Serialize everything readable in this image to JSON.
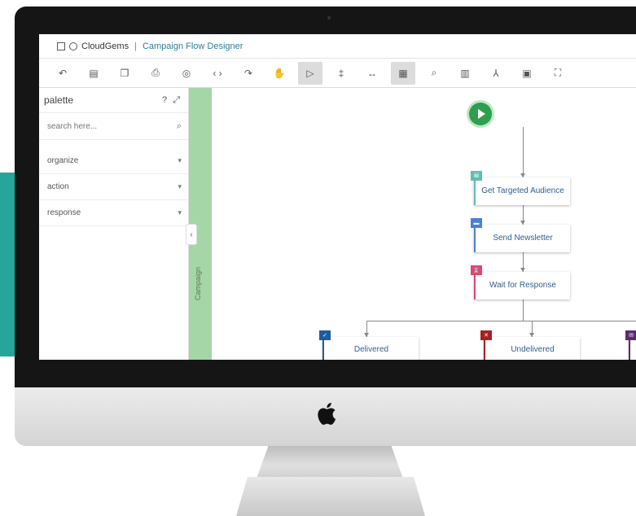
{
  "window": {
    "brand": "CloudGems",
    "separator": "|",
    "title": "Campaign Flow Designer"
  },
  "toolbar": {
    "tools": [
      {
        "icon": "undo-icon",
        "glyph": "↶",
        "active": false
      },
      {
        "icon": "page-icon",
        "glyph": "▤",
        "active": false
      },
      {
        "icon": "copy-icon",
        "glyph": "❐",
        "active": false
      },
      {
        "icon": "print-icon",
        "glyph": "⎙",
        "active": false
      },
      {
        "icon": "eye-icon",
        "glyph": "◎",
        "active": false
      },
      {
        "icon": "code-icon",
        "glyph": "‹ ›",
        "active": false
      },
      {
        "icon": "redo-icon",
        "glyph": "↷",
        "active": false
      },
      {
        "icon": "hand-icon",
        "glyph": "✋",
        "active": false
      },
      {
        "icon": "pointer-icon",
        "glyph": "▷",
        "active": true
      },
      {
        "icon": "vertical-split-icon",
        "glyph": "‡",
        "active": false
      },
      {
        "icon": "horizontal-split-icon",
        "glyph": "↔",
        "active": false
      },
      {
        "icon": "grid-icon",
        "glyph": "▦",
        "active": true
      },
      {
        "icon": "zoom-icon",
        "glyph": "⌕",
        "active": false
      },
      {
        "icon": "columns-icon",
        "glyph": "▥",
        "active": false
      },
      {
        "icon": "person-icon",
        "glyph": "⅄",
        "active": false
      },
      {
        "icon": "save-icon",
        "glyph": "▣",
        "active": false
      },
      {
        "icon": "fullscreen-icon",
        "glyph": "⛶",
        "active": false
      }
    ]
  },
  "palette": {
    "title": "palette",
    "header_icons": "? ⤢",
    "search_placeholder": "search here...",
    "sections": [
      {
        "label": "organize"
      },
      {
        "label": "action"
      },
      {
        "label": "response"
      }
    ]
  },
  "swimlane": {
    "label": "Campaign"
  },
  "flow": {
    "nodes": [
      {
        "id": "target",
        "label": "Get Targeted Audience",
        "color": "#5fbfb2",
        "badge_icon": "audience-icon",
        "badge_text": "iii"
      },
      {
        "id": "newsletter",
        "label": "Send Newsletter",
        "color": "#4a80d6",
        "badge_icon": "newsletter-icon",
        "badge_text": "▬"
      },
      {
        "id": "wait",
        "label": "Wait for Response",
        "color": "#e0457b",
        "badge_icon": "wait-icon",
        "badge_text": "⌛"
      },
      {
        "id": "delivered",
        "label": "Delivered",
        "color": "#1e5c9e",
        "badge_icon": "delivered-icon",
        "badge_text": "✓"
      },
      {
        "id": "undelivered",
        "label": "Undelivered",
        "color": "#a52222",
        "badge_icon": "undelivered-icon",
        "badge_text": "✕"
      },
      {
        "id": "opened",
        "label": "",
        "color": "#5b2d6e",
        "badge_icon": "email-icon",
        "badge_text": "✉"
      }
    ]
  },
  "colors": {
    "teal_accent": "#26a69a",
    "swimlane": "#a5d6a7",
    "start": "#2e9e4f",
    "title_link": "#2e7d9a"
  }
}
